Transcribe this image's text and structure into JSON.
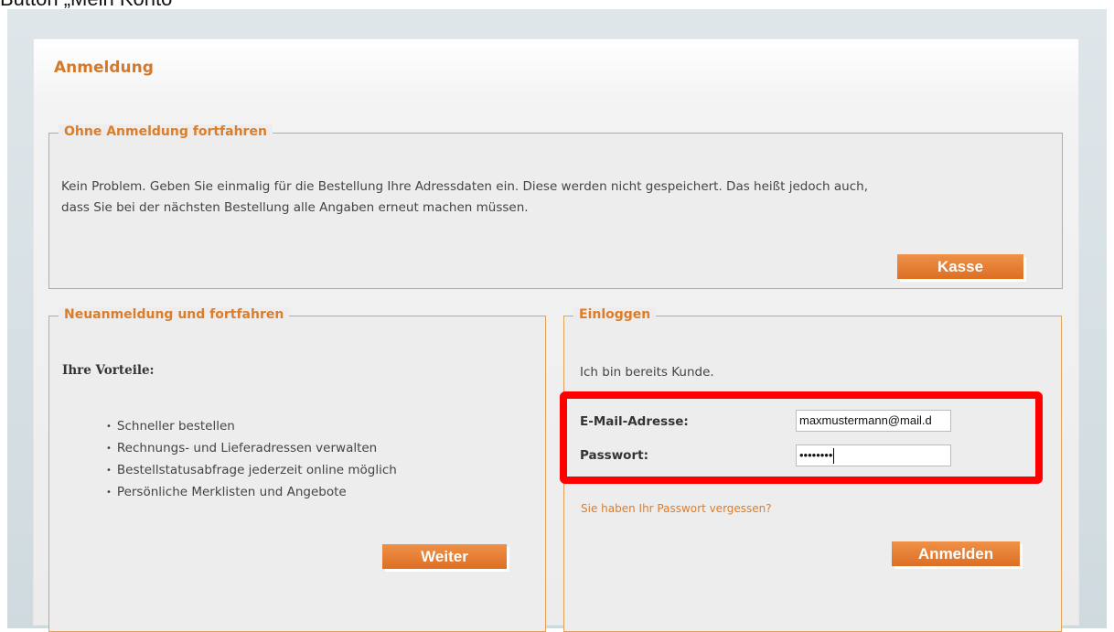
{
  "caption": "Button „Mein Konto“",
  "page": {
    "title": "Anmeldung"
  },
  "guest": {
    "legend": "Ohne Anmeldung fortfahren",
    "line1": "Kein Problem. Geben Sie einmalig für die Bestellung Ihre Adressdaten ein. Diese werden nicht gespeichert. Das heißt jedoch auch,",
    "line2": "dass Sie bei der nächsten Bestellung alle Angaben erneut machen müssen.",
    "button": "Kasse"
  },
  "register": {
    "legend": "Neuanmeldung und fortfahren",
    "benefits_title": "Ihre Vorteile:",
    "benefits": [
      "Schneller bestellen",
      "Rechnungs- und Lieferadressen verwalten",
      "Bestellstatusabfrage jederzeit online möglich",
      "Persönliche Merklisten und Angebote"
    ],
    "button": "Weiter"
  },
  "login": {
    "legend": "Einloggen",
    "intro": "Ich bin bereits Kunde.",
    "email_label": "E-Mail-Adresse:",
    "email_value": "maxmustermann@mail.d",
    "password_label": "Passwort:",
    "password_value": "••••••••",
    "forgot_link": "Sie haben Ihr Passwort vergessen?",
    "button": "Anmelden"
  },
  "colors": {
    "accent": "#dc7d2a",
    "button": "#e27a2e",
    "border": "#e2a156",
    "highlight": "#ff0000"
  }
}
